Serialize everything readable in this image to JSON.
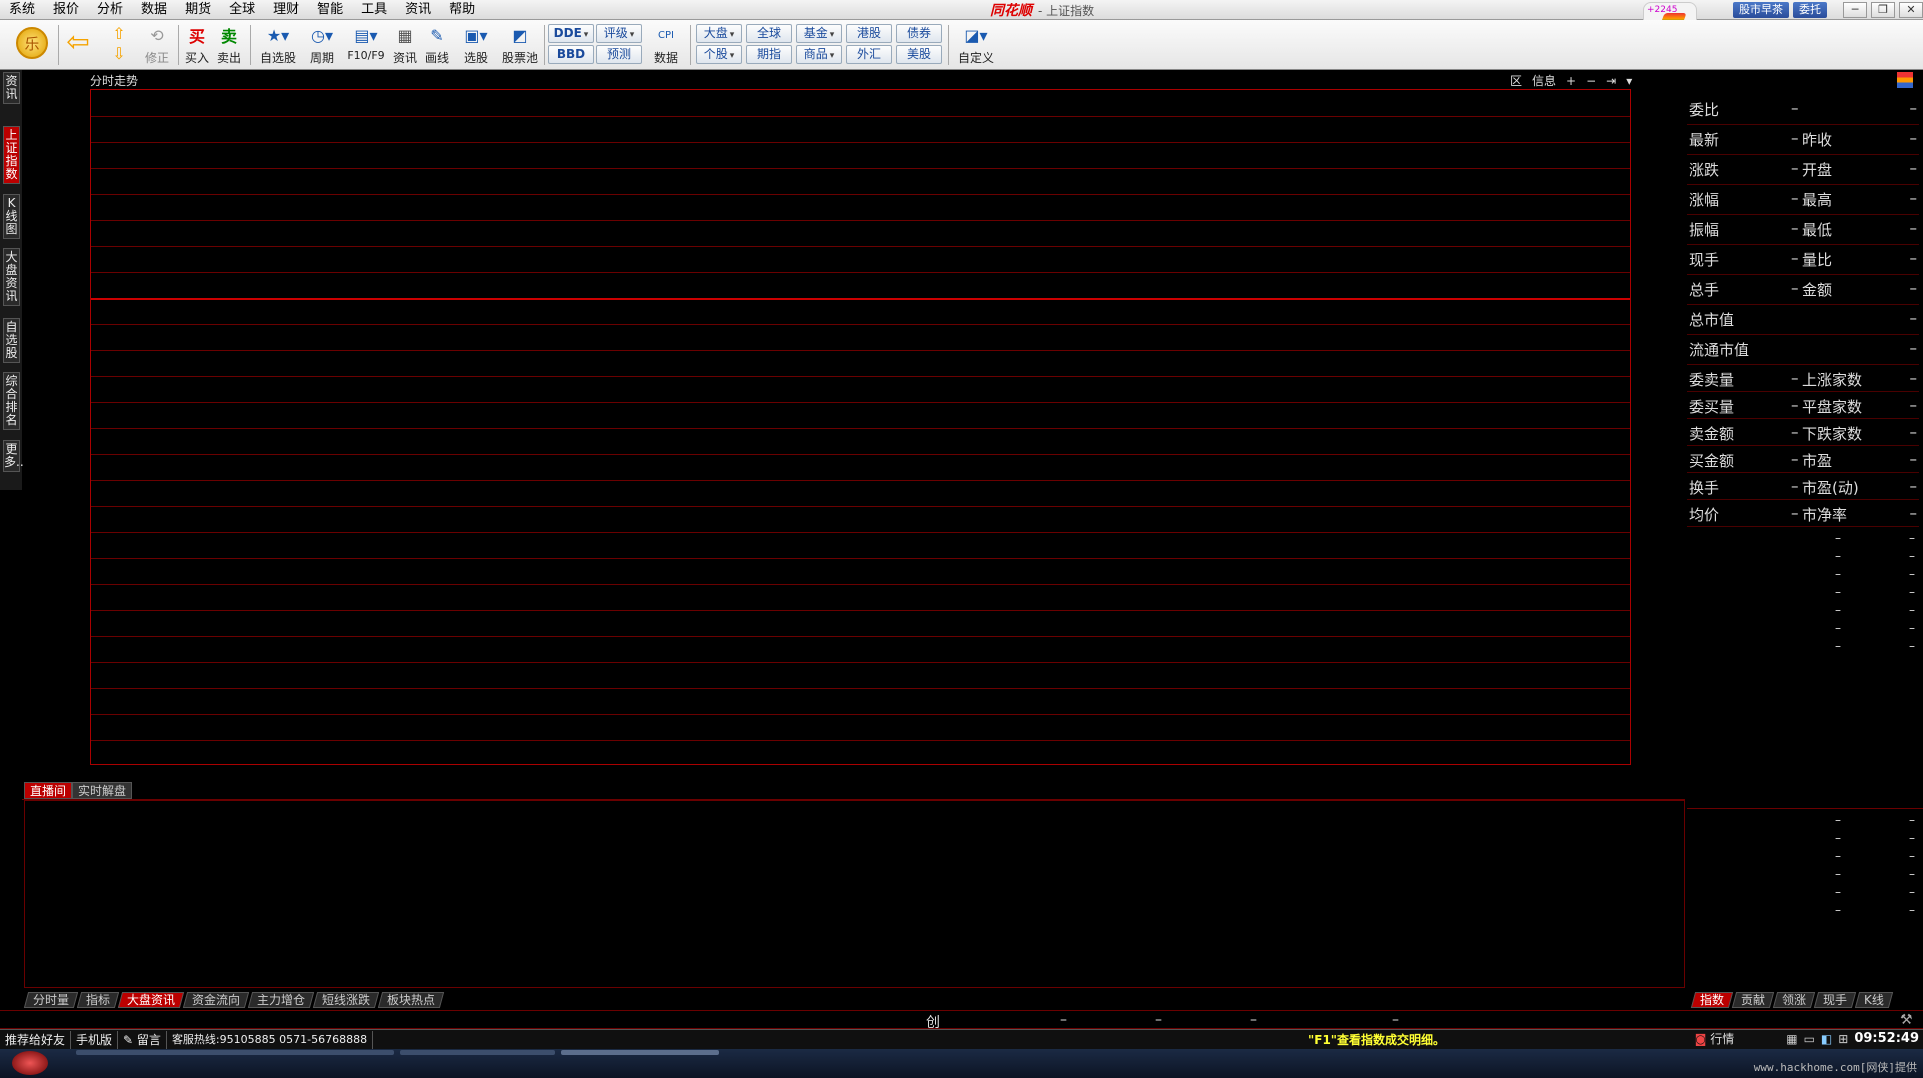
{
  "menu": [
    "系统",
    "报价",
    "分析",
    "数据",
    "期货",
    "全球",
    "理财",
    "智能",
    "工具",
    "资讯",
    "帮助"
  ],
  "brand": "同花顺",
  "window_title": "- 上证指数",
  "tray": {
    "badge_count": "+2245",
    "news_button": "股市早茶",
    "entrust_button": "委托",
    "minimize": "─",
    "restore": "❐",
    "close": "✕"
  },
  "toolbar": {
    "le": "乐",
    "buy": "买入",
    "sell": "卖出",
    "fix": "修正",
    "watchlist": "自选股",
    "period": "周期",
    "f10": "F10/F9",
    "news": "资讯",
    "draw": "画线",
    "pick": "选股",
    "pool": "股票池",
    "dde": "DDE",
    "bbd": "BBD",
    "rating": "评级",
    "forecast": "预测",
    "data": "数据",
    "dapan": "大盘",
    "gegu": "个股",
    "global": "全球",
    "futures_index": "期指",
    "fund": "基金",
    "commodity": "商品",
    "hk": "港股",
    "forex": "外汇",
    "bond": "债券",
    "us": "美股",
    "custom": "自定义",
    "buy_glyph": "买",
    "sell_glyph": "卖",
    "cpi": "CPI"
  },
  "left_tabs": [
    "资讯",
    "上证指数",
    "K线图",
    "大盘资讯",
    "自选股",
    "综合排名",
    "更多.."
  ],
  "chart": {
    "title": "分时走势",
    "tools": [
      "区",
      "信息",
      "+",
      "−",
      "⇥",
      "▾"
    ]
  },
  "quote_rows": [
    {
      "l1": "委比",
      "d1": "–",
      "l2": "",
      "d2": "–"
    },
    {
      "l1": "最新",
      "d1": "–",
      "l2": "昨收",
      "d2": "–"
    },
    {
      "l1": "涨跌",
      "d1": "–",
      "l2": "开盘",
      "d2": "–"
    },
    {
      "l1": "涨幅",
      "d1": "–",
      "l2": "最高",
      "d2": "–"
    },
    {
      "l1": "振幅",
      "d1": "–",
      "l2": "最低",
      "d2": "–"
    },
    {
      "l1": "现手",
      "d1": "–",
      "l2": "量比",
      "d2": "–"
    },
    {
      "l1": "总手",
      "d1": "–",
      "l2": "金额",
      "d2": "–"
    }
  ],
  "cap_rows": [
    {
      "l1": "总市值",
      "d2": "–"
    },
    {
      "l1": "流通市值",
      "d2": "–"
    }
  ],
  "order_rows": [
    {
      "l1": "委卖量",
      "d1": "–",
      "l2": "上涨家数",
      "d2": "–"
    },
    {
      "l1": "委买量",
      "d1": "–",
      "l2": "平盘家数",
      "d2": "–"
    },
    {
      "l1": "卖金额",
      "d1": "–",
      "l2": "下跌家数",
      "d2": "–"
    },
    {
      "l1": "买金额",
      "d1": "–",
      "l2": "市盈",
      "d2": "–"
    },
    {
      "l1": "换手",
      "d1": "–",
      "l2": "市盈(动)",
      "d2": "–"
    },
    {
      "l1": "均价",
      "d1": "–",
      "l2": "市净率",
      "d2": "–"
    }
  ],
  "dash": "–",
  "news_tabs": [
    "直播间",
    "实时解盘"
  ],
  "bottom_tabs": [
    "分时量",
    "指标",
    "大盘资讯",
    "资金流向",
    "主力增仓",
    "短线涨跌",
    "板块热点"
  ],
  "right_bottom_tabs": [
    "指数",
    "贡献",
    "领涨",
    "现手",
    "K线"
  ],
  "index_strip": {
    "label": "创",
    "v1": "–",
    "v2": "–",
    "v3": "–",
    "v4": "–"
  },
  "status": {
    "recommend": "推荐给好友",
    "mobile": "手机版",
    "message": "留言",
    "hotline": "客服热线:95105885  0571-56768888",
    "tip": "\"F1\"查看指数成交明细。",
    "market": "行情",
    "clock": "09:52:49"
  },
  "watermark": "www.hackhome.com[网侠]提供"
}
